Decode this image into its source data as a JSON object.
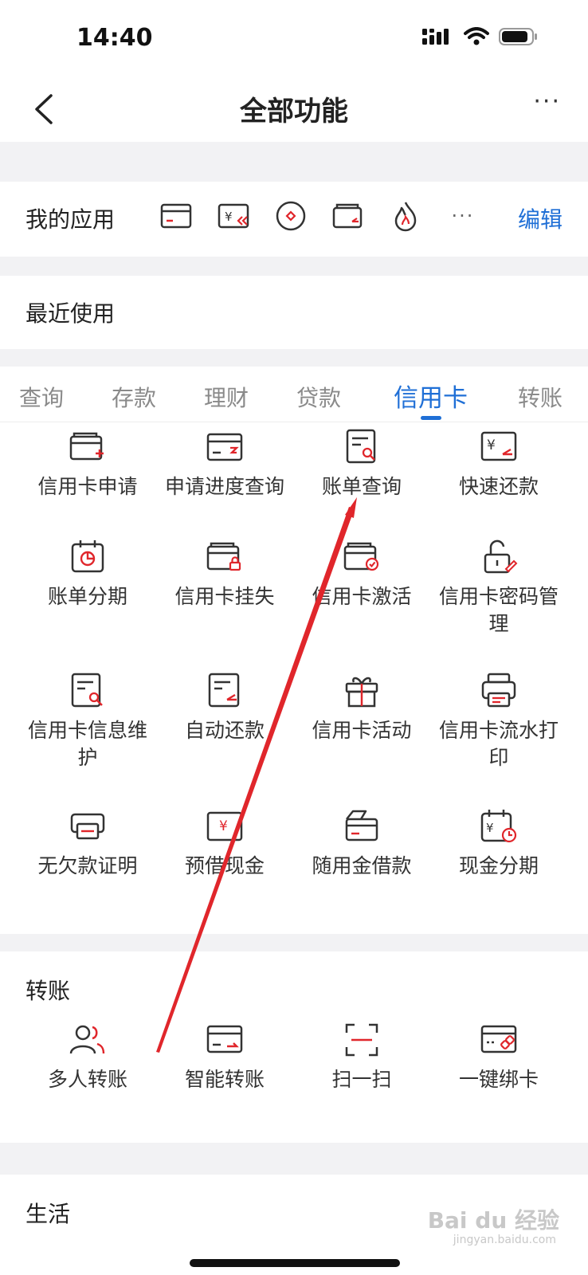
{
  "status_bar": {
    "time": "14:40"
  },
  "nav": {
    "title": "全部功能",
    "more": "···"
  },
  "my_apps": {
    "label": "我的应用",
    "more": "···",
    "edit": "编辑"
  },
  "recent": {
    "label": "最近使用"
  },
  "tabs": [
    {
      "label": "查询"
    },
    {
      "label": "存款"
    },
    {
      "label": "理财"
    },
    {
      "label": "贷款"
    },
    {
      "label": "信用卡",
      "active": true
    },
    {
      "label": "转账"
    }
  ],
  "credit_items": [
    {
      "label": "信用卡申请",
      "icon": "card-plus-icon"
    },
    {
      "label": "申请进度查询",
      "icon": "card-hourglass-icon"
    },
    {
      "label": "账单查询",
      "icon": "bill-search-icon"
    },
    {
      "label": "快速还款",
      "icon": "yen-card-icon"
    },
    {
      "label": "账单分期",
      "icon": "calendar-pie-icon"
    },
    {
      "label": "信用卡挂失",
      "icon": "card-lock-icon"
    },
    {
      "label": "信用卡激活",
      "icon": "card-check-icon"
    },
    {
      "label": "信用卡密码管理",
      "icon": "unlock-pen-icon"
    },
    {
      "label": "信用卡信息维护",
      "icon": "doc-search-icon"
    },
    {
      "label": "自动还款",
      "icon": "doc-return-icon"
    },
    {
      "label": "信用卡活动",
      "icon": "gift-icon"
    },
    {
      "label": "信用卡流水打印",
      "icon": "printer-icon"
    },
    {
      "label": "无欠款证明",
      "icon": "certificate-printer-icon"
    },
    {
      "label": "预借现金",
      "icon": "yen-card-cash-icon"
    },
    {
      "label": "随用金借款",
      "icon": "card-hand-icon"
    },
    {
      "label": "现金分期",
      "icon": "yen-calendar-clock-icon"
    }
  ],
  "transfer": {
    "title": "转账",
    "items": [
      {
        "label": "多人转账",
        "icon": "multi-user-icon"
      },
      {
        "label": "智能转账",
        "icon": "card-transfer-icon"
      },
      {
        "label": "扫一扫",
        "icon": "scan-icon"
      },
      {
        "label": "一键绑卡",
        "icon": "card-link-icon"
      }
    ]
  },
  "life": {
    "title": "生活"
  },
  "watermark": {
    "text": "Bai du 经验",
    "sub": "jingyan.baidu.com"
  },
  "colors": {
    "accent": "#1f6fd6",
    "icon_red": "#e0262b",
    "icon_dark": "#333333"
  }
}
